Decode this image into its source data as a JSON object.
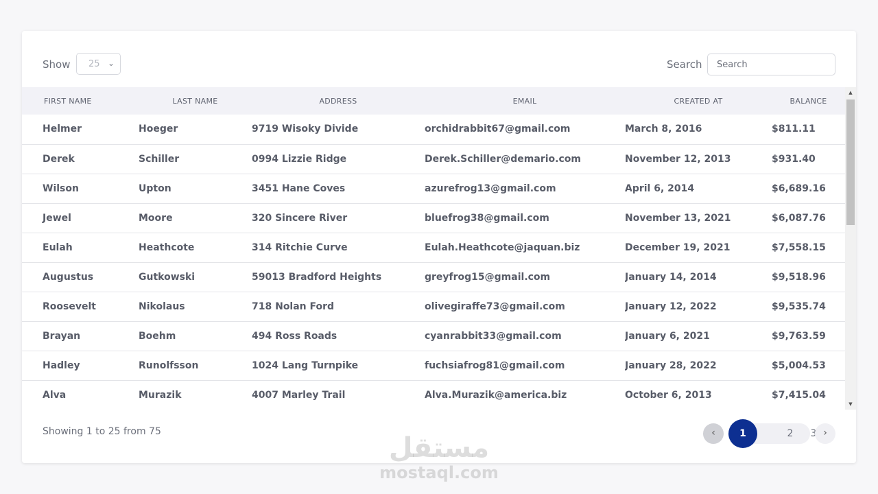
{
  "controls": {
    "show_label": "Show",
    "page_size": "25",
    "search_label": "Search",
    "search_placeholder": "Search"
  },
  "table": {
    "headers": [
      "FIRST NAME",
      "LAST NAME",
      "ADDRESS",
      "EMAIL",
      "CREATED AT",
      "BALANCE"
    ],
    "rows": [
      [
        "Helmer",
        "Hoeger",
        "9719 Wisoky Divide",
        "orchidrabbit67@gmail.com",
        "March 8, 2016",
        "$811.11"
      ],
      [
        "Derek",
        "Schiller",
        "0994 Lizzie Ridge",
        "Derek.Schiller@demario.com",
        "November 12, 2013",
        "$931.40"
      ],
      [
        "Wilson",
        "Upton",
        "3451 Hane Coves",
        "azurefrog13@gmail.com",
        "April 6, 2014",
        "$6,689.16"
      ],
      [
        "Jewel",
        "Moore",
        "320 Sincere River",
        "bluefrog38@gmail.com",
        "November 13, 2021",
        "$6,087.76"
      ],
      [
        "Eulah",
        "Heathcote",
        "314 Ritchie Curve",
        "Eulah.Heathcote@jaquan.biz",
        "December 19, 2021",
        "$7,558.15"
      ],
      [
        "Augustus",
        "Gutkowski",
        "59013 Bradford Heights",
        "greyfrog15@gmail.com",
        "January 14, 2014",
        "$9,518.96"
      ],
      [
        "Roosevelt",
        "Nikolaus",
        "718 Nolan Ford",
        "olivegiraffe73@gmail.com",
        "January 12, 2022",
        "$9,535.74"
      ],
      [
        "Brayan",
        "Boehm",
        "494 Ross Roads",
        "cyanrabbit33@gmail.com",
        "January 6, 2021",
        "$9,763.59"
      ],
      [
        "Hadley",
        "Runolfsson",
        "1024 Lang Turnpike",
        "fuchsiafrog81@gmail.com",
        "January 28, 2022",
        "$5,004.53"
      ],
      [
        "Alva",
        "Murazik",
        "4007 Marley Trail",
        "Alva.Murazik@america.biz",
        "October 6, 2013",
        "$7,415.04"
      ]
    ]
  },
  "footer": {
    "showing_text": "Showing 1 to 25 from 75",
    "pages": [
      "1",
      "2",
      "3"
    ],
    "active_page": "1"
  },
  "watermark": {
    "arabic": "مستقل",
    "latin": "mostaql.com"
  },
  "icons": {
    "select_chevron": "chevron-down-icon",
    "prev": "chevron-left-icon",
    "next": "chevron-right-icon"
  },
  "colors": {
    "accent": "#0d2f91",
    "header_bg": "#f2f2f7"
  }
}
